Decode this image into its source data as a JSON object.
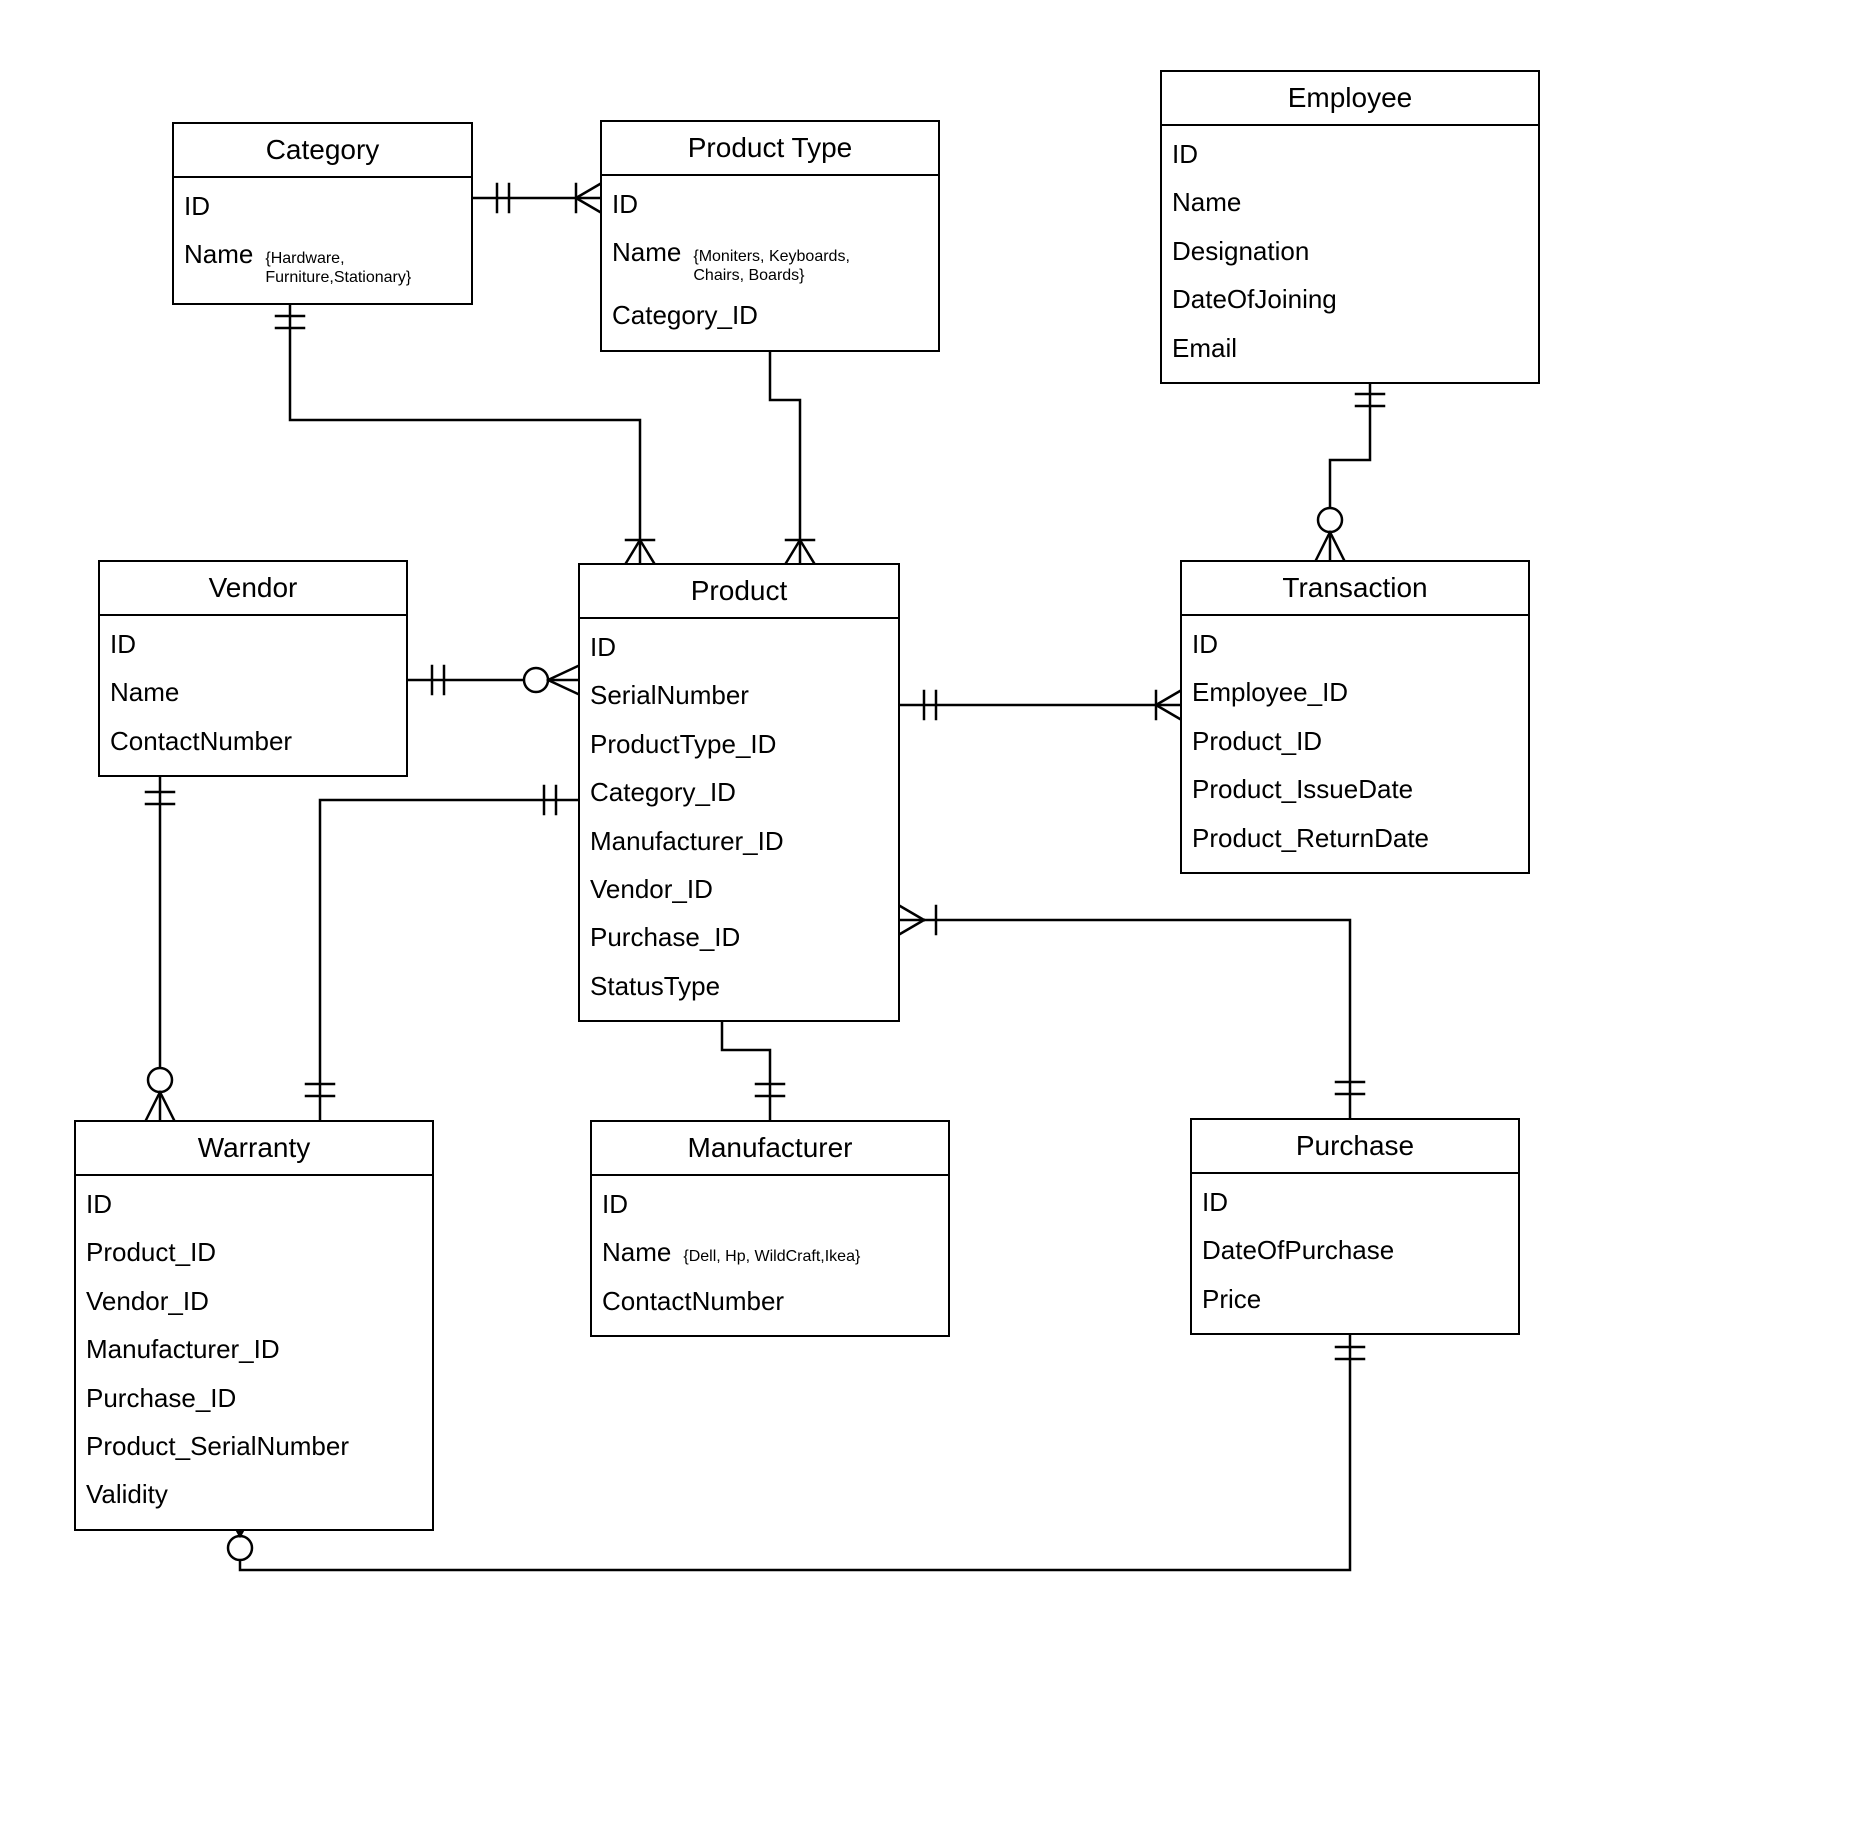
{
  "entities": {
    "category": {
      "title": "Category",
      "attrs": [
        "ID",
        "Name"
      ],
      "notes": {
        "1": "{Hardware,\nFurniture,Stationary}"
      }
    },
    "product_type": {
      "title": "Product Type",
      "attrs": [
        "ID",
        "Name",
        "Category_ID"
      ],
      "notes": {
        "1": "{Moniters, Keyboards,\nChairs, Boards}"
      }
    },
    "employee": {
      "title": "Employee",
      "attrs": [
        "ID",
        "Name",
        "Designation",
        "DateOfJoining",
        "Email"
      ]
    },
    "vendor": {
      "title": "Vendor",
      "attrs": [
        "ID",
        "Name",
        "ContactNumber"
      ]
    },
    "product": {
      "title": "Product",
      "attrs": [
        "ID",
        "SerialNumber",
        "ProductType_ID",
        "Category_ID",
        "Manufacturer_ID",
        "Vendor_ID",
        "Purchase_ID",
        "StatusType"
      ]
    },
    "transaction": {
      "title": "Transaction",
      "attrs": [
        "ID",
        "Employee_ID",
        "Product_ID",
        "Product_IssueDate",
        "Product_ReturnDate"
      ]
    },
    "warranty": {
      "title": "Warranty",
      "attrs": [
        "ID",
        "Product_ID",
        "Vendor_ID",
        "Manufacturer_ID",
        "Purchase_ID",
        "Product_SerialNumber",
        "Validity"
      ]
    },
    "manufacturer": {
      "title": "Manufacturer",
      "attrs": [
        "ID",
        "Name",
        "ContactNumber"
      ],
      "notes": {
        "1": "{Dell, Hp, WildCraft,Ikea}"
      }
    },
    "purchase": {
      "title": "Purchase",
      "attrs": [
        "ID",
        "DateOfPurchase",
        "Price"
      ]
    }
  },
  "chart_data": {
    "type": "er-diagram",
    "entities": [
      {
        "name": "Category",
        "attributes": [
          "ID",
          "Name"
        ],
        "example_values": {
          "Name": [
            "Hardware",
            "Furniture",
            "Stationary"
          ]
        }
      },
      {
        "name": "Product Type",
        "attributes": [
          "ID",
          "Name",
          "Category_ID"
        ],
        "example_values": {
          "Name": [
            "Moniters",
            "Keyboards",
            "Chairs",
            "Boards"
          ]
        }
      },
      {
        "name": "Employee",
        "attributes": [
          "ID",
          "Name",
          "Designation",
          "DateOfJoining",
          "Email"
        ]
      },
      {
        "name": "Vendor",
        "attributes": [
          "ID",
          "Name",
          "ContactNumber"
        ]
      },
      {
        "name": "Product",
        "attributes": [
          "ID",
          "SerialNumber",
          "ProductType_ID",
          "Category_ID",
          "Manufacturer_ID",
          "Vendor_ID",
          "Purchase_ID",
          "StatusType"
        ]
      },
      {
        "name": "Transaction",
        "attributes": [
          "ID",
          "Employee_ID",
          "Product_ID",
          "Product_IssueDate",
          "Product_ReturnDate"
        ]
      },
      {
        "name": "Warranty",
        "attributes": [
          "ID",
          "Product_ID",
          "Vendor_ID",
          "Manufacturer_ID",
          "Purchase_ID",
          "Product_SerialNumber",
          "Validity"
        ]
      },
      {
        "name": "Manufacturer",
        "attributes": [
          "ID",
          "Name",
          "ContactNumber"
        ],
        "example_values": {
          "Name": [
            "Dell",
            "Hp",
            "WildCraft",
            "Ikea"
          ]
        }
      },
      {
        "name": "Purchase",
        "attributes": [
          "ID",
          "DateOfPurchase",
          "Price"
        ]
      }
    ],
    "relationships": [
      {
        "from": "Category",
        "to": "Product Type",
        "from_card": "one-mandatory",
        "to_card": "many-mandatory"
      },
      {
        "from": "Category",
        "to": "Product",
        "from_card": "one-mandatory",
        "to_card": "many-mandatory"
      },
      {
        "from": "Product Type",
        "to": "Product",
        "from_card": "one-mandatory",
        "to_card": "many-mandatory"
      },
      {
        "from": "Vendor",
        "to": "Product",
        "from_card": "one-mandatory",
        "to_card": "many-optional"
      },
      {
        "from": "Vendor",
        "to": "Warranty",
        "from_card": "one-mandatory",
        "to_card": "many-optional"
      },
      {
        "from": "Product",
        "to": "Warranty",
        "from_card": "one-mandatory",
        "to_card": "one-mandatory"
      },
      {
        "from": "Product",
        "to": "Manufacturer",
        "from_card": "many-mandatory",
        "to_card": "one-mandatory"
      },
      {
        "from": "Product",
        "to": "Transaction",
        "from_card": "one-mandatory",
        "to_card": "many-mandatory"
      },
      {
        "from": "Product",
        "to": "Purchase",
        "from_card": "many-mandatory",
        "to_card": "one-mandatory"
      },
      {
        "from": "Employee",
        "to": "Transaction",
        "from_card": "one-mandatory",
        "to_card": "many-optional"
      },
      {
        "from": "Purchase",
        "to": "Warranty",
        "from_card": "one-mandatory",
        "to_card": "many-optional"
      }
    ]
  }
}
